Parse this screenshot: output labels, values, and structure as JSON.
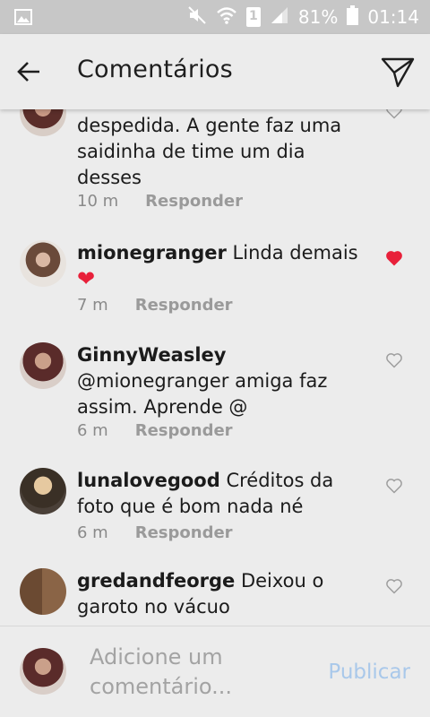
{
  "status_bar": {
    "battery_percent": "81%",
    "time": "01:14",
    "sim_label": "1"
  },
  "header": {
    "title": "Comentários"
  },
  "comments": [
    {
      "text_line": "despedida. A gente faz uma saidinha de time um dia desses",
      "time": "10 m",
      "reply_label": "Responder",
      "liked": false
    },
    {
      "username": "mionegranger",
      "text": "Linda demais",
      "emoji": "❤",
      "time": "7 m",
      "reply_label": "Responder",
      "liked": true
    },
    {
      "username": "GinnyWeasley",
      "text": "@mionegranger amiga faz assim. Aprende @",
      "time": "6 m",
      "reply_label": "Responder",
      "liked": false
    },
    {
      "username": "lunalovegood",
      "text": "Créditos da foto que é bom nada né",
      "time": "6 m",
      "reply_label": "Responder",
      "liked": false
    },
    {
      "username": "gredandfeorge",
      "text": "Deixou o garoto no vácuo",
      "liked": false
    }
  ],
  "composer": {
    "placeholder": "Adicione um comentário...",
    "publish_label": "Publicar"
  },
  "colors": {
    "background": "#ececec",
    "status_bar": "#c7c7c7",
    "like_red": "#e8203a",
    "publish_disabled": "#a9c8ea",
    "meta_gray": "#8a8a8a"
  }
}
